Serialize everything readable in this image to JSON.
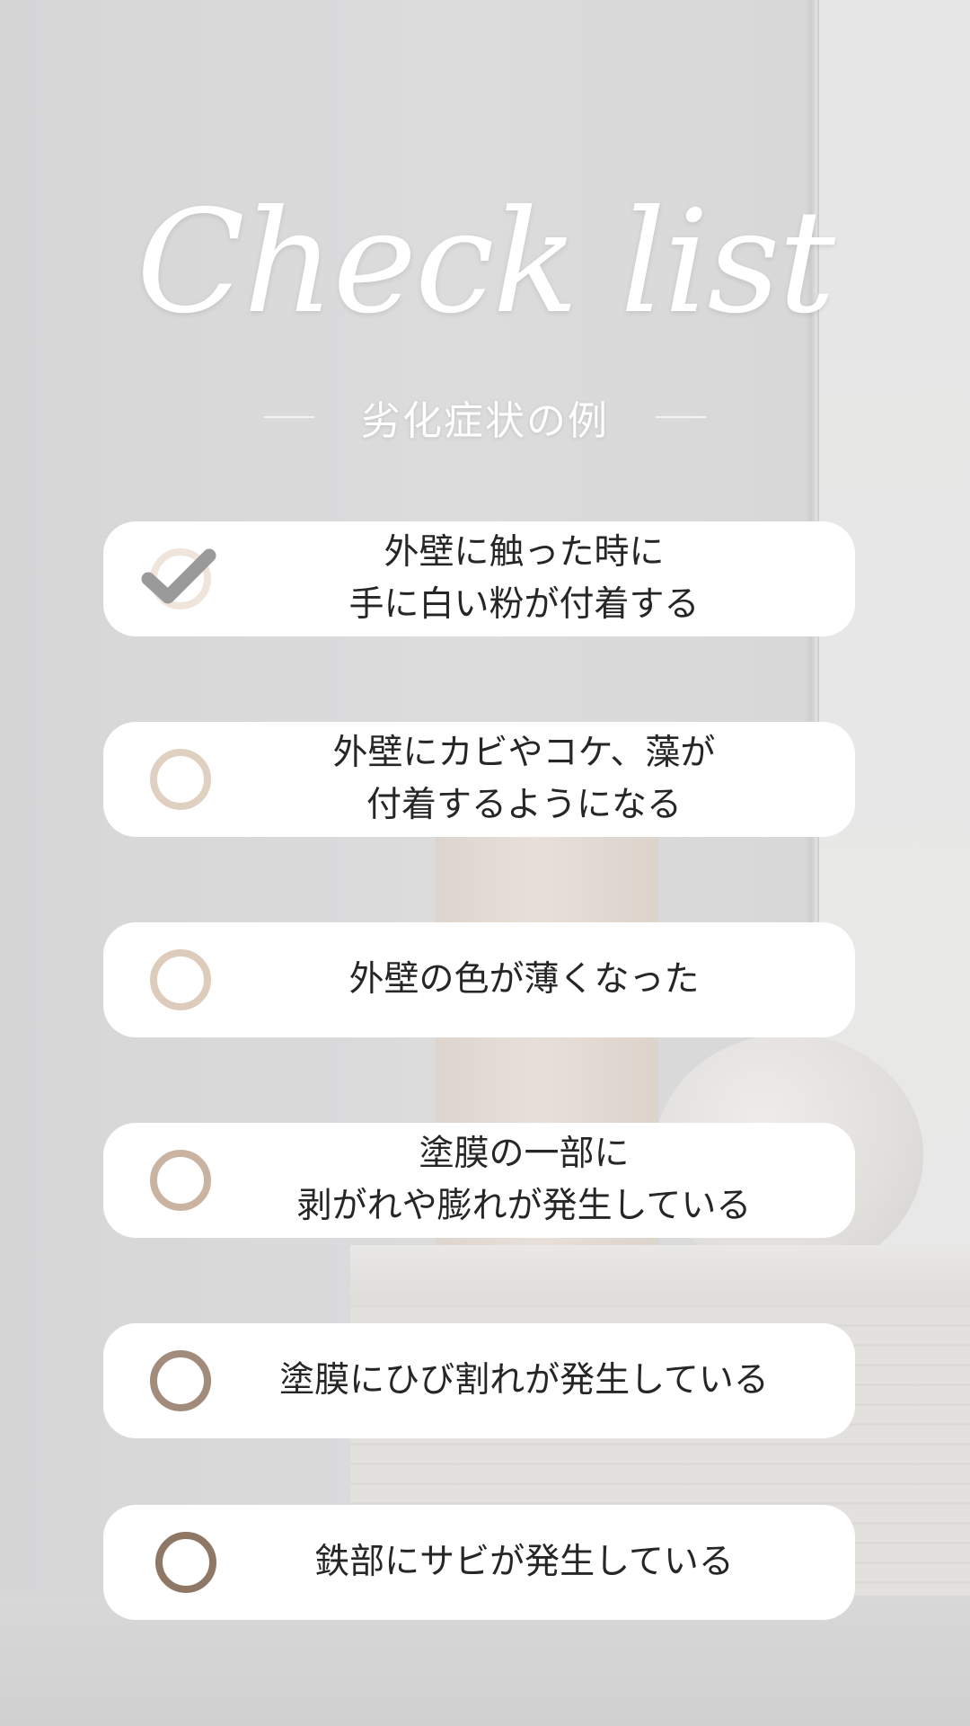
{
  "header": {
    "title": "Check list",
    "subtitle": "劣化症状の例"
  },
  "colors": {
    "card_bg": "#ffffff",
    "text": "#262626",
    "circle_light": "#e6d8c9",
    "circle_mid": "#d3bfae",
    "circle_dark": "#9c8575",
    "check_mark": "#9a9a9a"
  },
  "items": [
    {
      "lines": [
        "外壁に触った時に",
        "手に白い粉が付着する"
      ],
      "checked": true,
      "icon": "check-icon"
    },
    {
      "lines": [
        "外壁にカビやコケ、藻が",
        "付着するようになる"
      ],
      "checked": false,
      "icon": "circle-icon"
    },
    {
      "lines": [
        "外壁の色が薄くなった"
      ],
      "checked": false,
      "icon": "circle-icon"
    },
    {
      "lines": [
        "塗膜の一部に",
        "剥がれや膨れが発生している"
      ],
      "checked": false,
      "icon": "circle-icon"
    },
    {
      "lines": [
        "塗膜にひび割れが発生している"
      ],
      "checked": false,
      "icon": "circle-icon"
    },
    {
      "lines": [
        "鉄部にサビが発生している"
      ],
      "checked": false,
      "icon": "circle-icon"
    }
  ]
}
